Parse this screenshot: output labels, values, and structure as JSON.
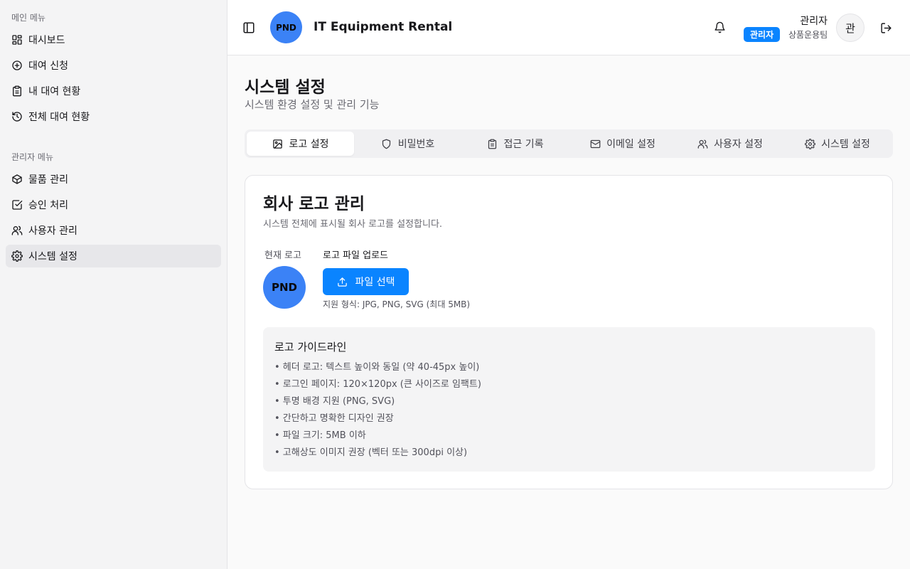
{
  "sidebar": {
    "main_group_label": "메인 메뉴",
    "main_items": [
      {
        "label": "대시보드",
        "icon": "layout-grid-icon"
      },
      {
        "label": "대여 신청",
        "icon": "plus-circle-icon"
      },
      {
        "label": "내 대여 현황",
        "icon": "clipboard-icon"
      },
      {
        "label": "전체 대여 현황",
        "icon": "history-icon"
      }
    ],
    "admin_group_label": "관리자 메뉴",
    "admin_items": [
      {
        "label": "물품 관리",
        "icon": "package-icon"
      },
      {
        "label": "승인 처리",
        "icon": "check-square-icon"
      },
      {
        "label": "사용자 관리",
        "icon": "users-icon"
      },
      {
        "label": "시스템 설정",
        "icon": "gear-icon",
        "active": true
      }
    ]
  },
  "header": {
    "logo_text": "PND",
    "title": "IT Equipment Rental",
    "user_name": "관리자",
    "role_badge": "관리자",
    "team": "상품운용팀",
    "avatar_text": "관"
  },
  "page": {
    "title": "시스템 설정",
    "subtitle": "시스템 환경 설정 및 관리 기능"
  },
  "tabs": [
    {
      "label": "로고 설정",
      "icon": "image-icon",
      "active": true
    },
    {
      "label": "비밀번호",
      "icon": "shield-icon"
    },
    {
      "label": "접근 기록",
      "icon": "clipboard-icon"
    },
    {
      "label": "이메일 설정",
      "icon": "mail-icon"
    },
    {
      "label": "사용자 설정",
      "icon": "users-icon"
    },
    {
      "label": "시스템 설정",
      "icon": "gear-icon"
    }
  ],
  "logo_card": {
    "title": "회사 로고 관리",
    "description": "시스템 전체에 표시될 회사 로고를 설정합니다.",
    "current_logo_label": "현재 로고",
    "current_logo_text": "PND",
    "upload_label": "로고 파일 업로드",
    "file_button": "파일 선택",
    "formats": "지원 형식: JPG, PNG, SVG (최대 5MB)",
    "guide_title": "로고 가이드라인",
    "guide_items": [
      "• 헤더 로고: 텍스트 높이와 동일 (약 40-45px 높이)",
      "• 로그인 페이지: 120×120px (큰 사이즈로 임팩트)",
      "• 투명 배경 지원 (PNG, SVG)",
      "• 간단하고 명확한 디자인 권장",
      "• 파일 크기: 5MB 이하",
      "• 고해상도 이미지 권장 (벡터 또는 300dpi 이상)"
    ]
  },
  "colors": {
    "accent": "#0a84ff",
    "logo_bg": "#3b82f6"
  }
}
